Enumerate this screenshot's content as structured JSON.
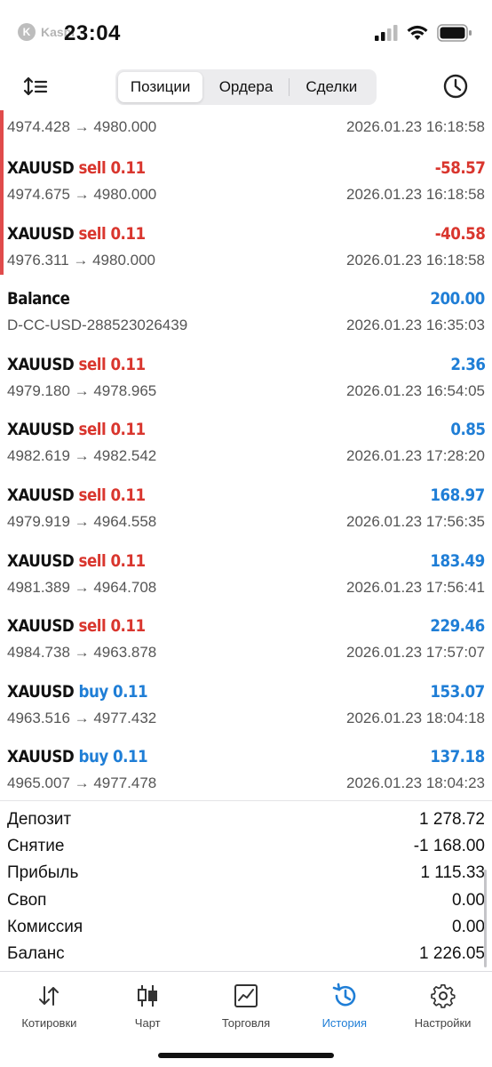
{
  "status_bar": {
    "time": "23:04",
    "carrier_overlay": "Kaspi",
    "carrier_overlay_suffix": ":"
  },
  "header": {
    "tabs": [
      {
        "label": "Позиции",
        "active": true
      },
      {
        "label": "Ордера",
        "active": false
      },
      {
        "label": "Сделки",
        "active": false
      }
    ]
  },
  "deals_partial": {
    "prices": "4974.428 → 4980.000",
    "time": "2026.01.23 16:18:58"
  },
  "deals": [
    {
      "symbol": "XAUUSD",
      "side": "sell 0.11",
      "side_type": "sell",
      "profit": "-58.57",
      "profit_sign": "neg",
      "prices": "4974.675 → 4980.000",
      "time": "2026.01.23 16:18:58",
      "marked": true
    },
    {
      "symbol": "XAUUSD",
      "side": "sell 0.11",
      "side_type": "sell",
      "profit": "-40.58",
      "profit_sign": "neg",
      "prices": "4976.311 → 4980.000",
      "time": "2026.01.23 16:18:58",
      "marked": true
    },
    {
      "symbol": "Balance",
      "side": "",
      "side_type": "none",
      "profit": "200.00",
      "profit_sign": "pos",
      "prices": "D-CC-USD-288523026439",
      "time": "2026.01.23 16:35:03",
      "marked": false
    },
    {
      "symbol": "XAUUSD",
      "side": "sell 0.11",
      "side_type": "sell",
      "profit": "2.36",
      "profit_sign": "pos",
      "prices": "4979.180 → 4978.965",
      "time": "2026.01.23 16:54:05",
      "marked": false
    },
    {
      "symbol": "XAUUSD",
      "side": "sell 0.11",
      "side_type": "sell",
      "profit": "0.85",
      "profit_sign": "pos",
      "prices": "4982.619 → 4982.542",
      "time": "2026.01.23 17:28:20",
      "marked": false
    },
    {
      "symbol": "XAUUSD",
      "side": "sell 0.11",
      "side_type": "sell",
      "profit": "168.97",
      "profit_sign": "pos",
      "prices": "4979.919 → 4964.558",
      "time": "2026.01.23 17:56:35",
      "marked": false
    },
    {
      "symbol": "XAUUSD",
      "side": "sell 0.11",
      "side_type": "sell",
      "profit": "183.49",
      "profit_sign": "pos",
      "prices": "4981.389 → 4964.708",
      "time": "2026.01.23 17:56:41",
      "marked": false
    },
    {
      "symbol": "XAUUSD",
      "side": "sell 0.11",
      "side_type": "sell",
      "profit": "229.46",
      "profit_sign": "pos",
      "prices": "4984.738 → 4963.878",
      "time": "2026.01.23 17:57:07",
      "marked": false
    },
    {
      "symbol": "XAUUSD",
      "side": "buy 0.11",
      "side_type": "buy",
      "profit": "153.07",
      "profit_sign": "pos",
      "prices": "4963.516 → 4977.432",
      "time": "2026.01.23 18:04:18",
      "marked": false
    },
    {
      "symbol": "XAUUSD",
      "side": "buy 0.11",
      "side_type": "buy",
      "profit": "137.18",
      "profit_sign": "pos",
      "prices": "4965.007 → 4977.478",
      "time": "2026.01.23 18:04:23",
      "marked": false
    }
  ],
  "summary": [
    {
      "label": "Депозит",
      "value": "1 278.72"
    },
    {
      "label": "Снятие",
      "value": "-1 168.00"
    },
    {
      "label": "Прибыль",
      "value": "1 115.33"
    },
    {
      "label": "Своп",
      "value": "0.00"
    },
    {
      "label": "Комиссия",
      "value": "0.00"
    },
    {
      "label": "Баланс",
      "value": "1 226.05"
    }
  ],
  "tabbar": [
    {
      "label": "Котировки",
      "icon": "quotes-arrows-icon",
      "active": false
    },
    {
      "label": "Чарт",
      "icon": "candlestick-chart-icon",
      "active": false
    },
    {
      "label": "Торговля",
      "icon": "trade-chart-icon",
      "active": false
    },
    {
      "label": "История",
      "icon": "history-clock-icon",
      "active": true
    },
    {
      "label": "Настройки",
      "icon": "settings-gear-icon",
      "active": false
    }
  ],
  "colors": {
    "sell": "#d9362e",
    "buy": "#1f7ed6",
    "profit_negative": "#d9362e",
    "profit_positive": "#1f7ed6",
    "active_tab": "#1f7ed6",
    "marker": "#e04b4b"
  }
}
